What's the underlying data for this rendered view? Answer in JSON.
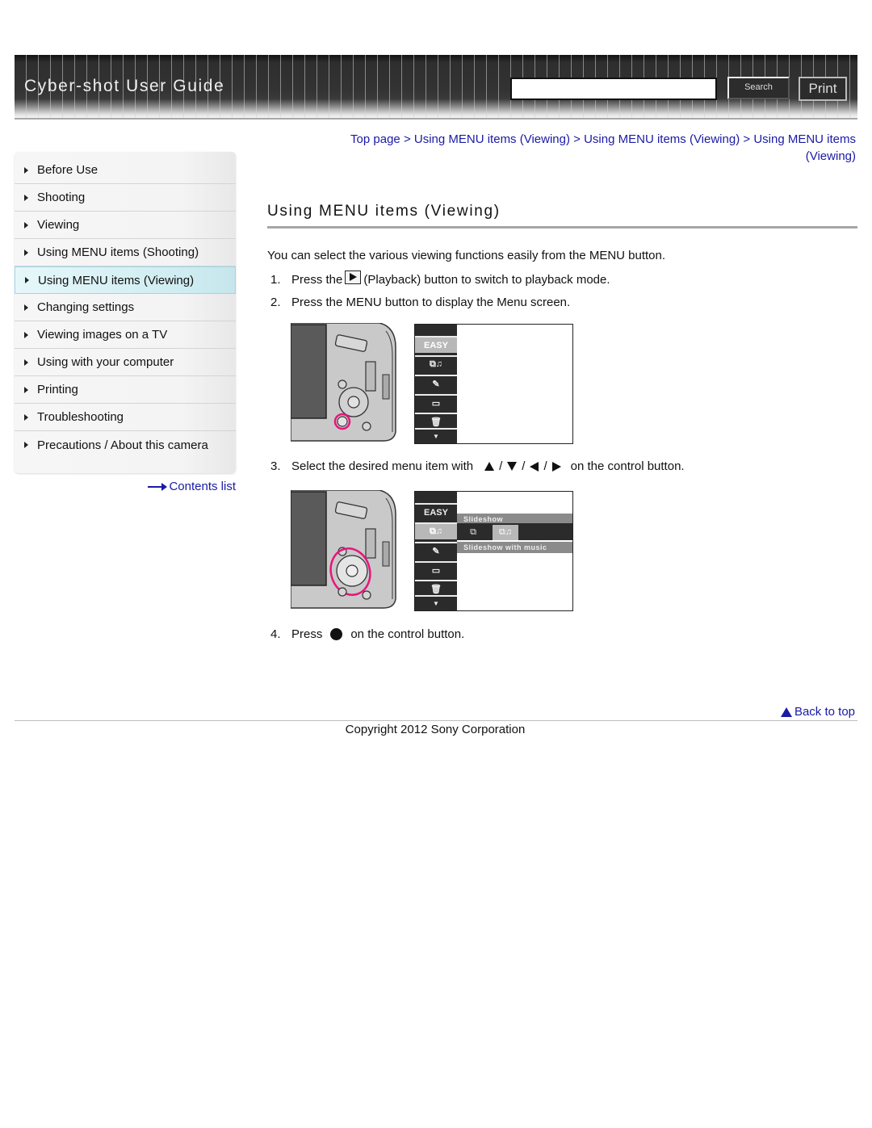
{
  "header": {
    "title": "Cyber-shot User Guide",
    "search_placeholder": "",
    "search_value": "",
    "search_label": "Search",
    "print_label": "Print"
  },
  "sidebar": {
    "items": [
      {
        "label": "Before Use",
        "active": false
      },
      {
        "label": "Shooting",
        "active": false
      },
      {
        "label": "Viewing",
        "active": false
      },
      {
        "label": "Using MENU items (Shooting)",
        "active": false
      },
      {
        "label": "Using MENU items (Viewing)",
        "active": true
      },
      {
        "label": "Changing settings",
        "active": false
      },
      {
        "label": "Viewing images on a TV",
        "active": false
      },
      {
        "label": "Using with your computer",
        "active": false
      },
      {
        "label": "Printing",
        "active": false
      },
      {
        "label": "Troubleshooting",
        "active": false
      },
      {
        "label": "Precautions / About this camera",
        "active": false
      }
    ],
    "contents_link": "Contents list"
  },
  "breadcrumb": {
    "items": [
      "Top page",
      "Using MENU items (Viewing)",
      "Using MENU items (Viewing)",
      "Using MENU items (Viewing)"
    ],
    "separator": ">"
  },
  "main": {
    "title": "Using MENU items (Viewing)",
    "intro": "You can select the various viewing functions easily from the MENU button.",
    "steps": [
      {
        "num": "1.",
        "before": "Press the",
        "icon": "playback-icon",
        "after": "(Playback) button to switch to playback mode."
      },
      {
        "num": "2.",
        "text": "Press the MENU button to display the Menu screen."
      },
      {
        "num": "3.",
        "before": "Select the desired menu item with",
        "icons": [
          "up-arrow-icon",
          "down-arrow-icon",
          "left-arrow-icon",
          "right-arrow-icon"
        ],
        "separator": "/",
        "after": "on the control button."
      },
      {
        "num": "4.",
        "before": "Press",
        "icon": "center-button-icon",
        "after": "on the control button."
      }
    ],
    "menu_screen": {
      "easy_label": "EASY",
      "slideshow_label": "Slideshow",
      "slideshow_music_label": "Slideshow with music"
    }
  },
  "footer": {
    "back_to_top": "Back to top",
    "copyright": "Copyright 2012 Sony Corporation"
  },
  "colors": {
    "link": "#1a1aa6",
    "header_bg": "#333333",
    "active_nav": "#cdecf1",
    "highlight_ring": "#e8157c"
  }
}
